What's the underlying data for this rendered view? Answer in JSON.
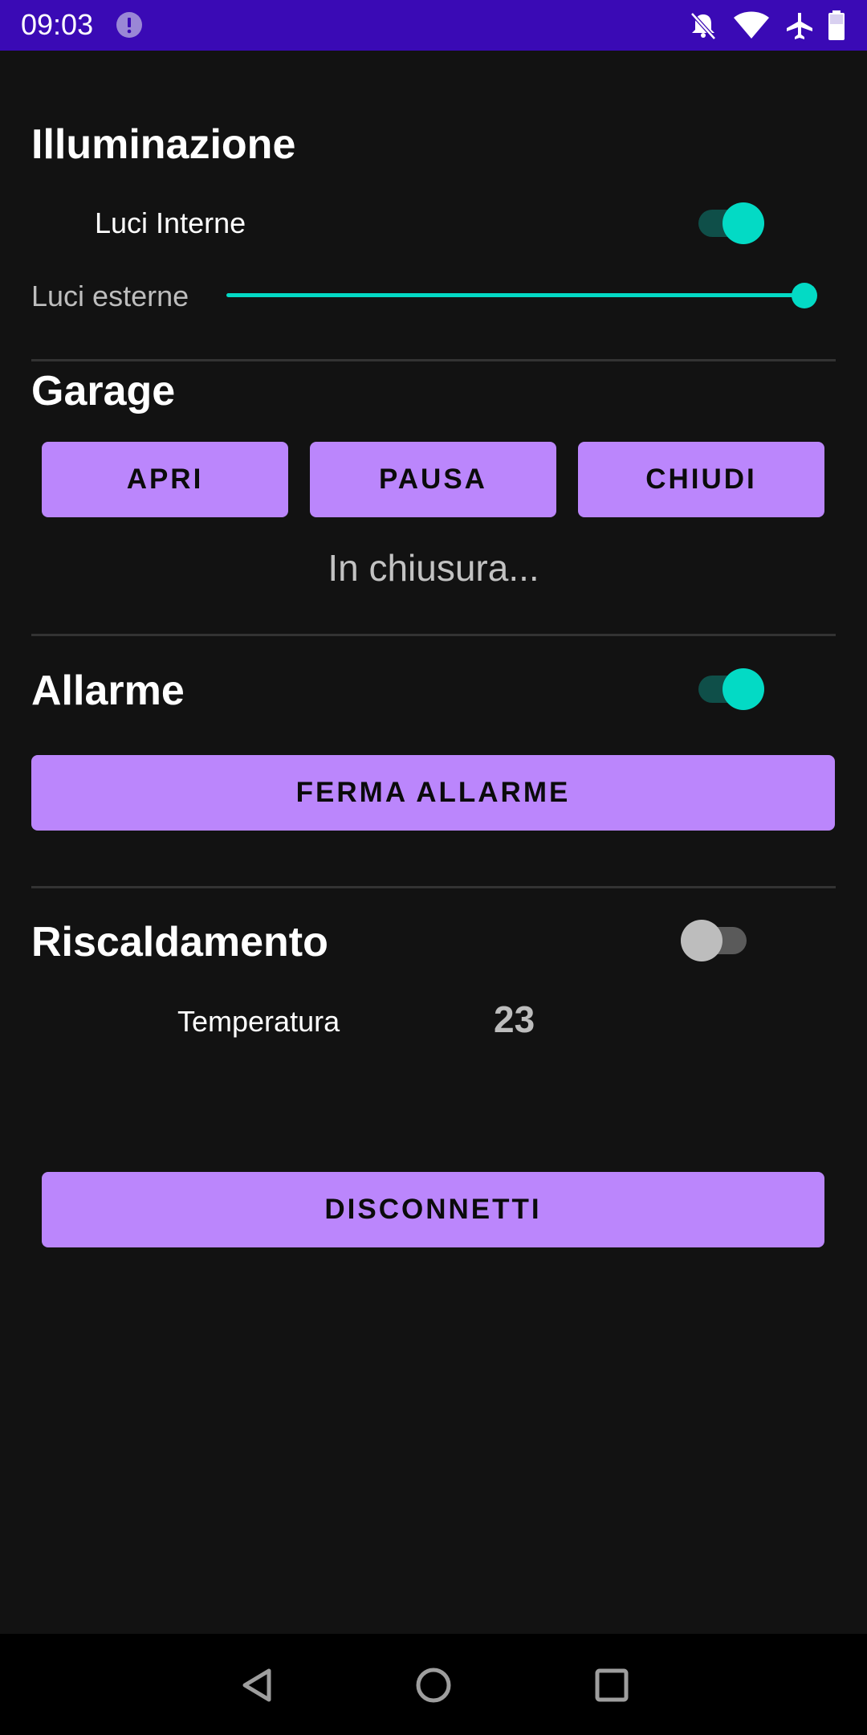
{
  "status_bar": {
    "time": "09:03",
    "color": "#3a0ab5",
    "icons": [
      "alert-icon",
      "bell-off-icon",
      "wifi-icon",
      "airplane-icon",
      "battery-icon"
    ]
  },
  "lighting": {
    "title": "Illuminazione",
    "internal_label": "Luci Interne",
    "internal_on": true,
    "external_label": "Luci esterne",
    "external_level": 1.0
  },
  "garage": {
    "title": "Garage",
    "buttons": [
      "APRI",
      "PAUSA",
      "CHIUDI"
    ],
    "status": "In chiusura..."
  },
  "alarm": {
    "title": "Allarme",
    "on": true,
    "stop_button": "FERMA ALLARME"
  },
  "heating": {
    "title": "Riscaldamento",
    "on": false,
    "temperature_label": "Temperatura",
    "temperature_value": "23"
  },
  "disconnect_button": "DISCONNETTI",
  "colors": {
    "accent": "#03dac5",
    "button": "#bb86fc",
    "background": "#121212"
  },
  "nav_icons": [
    "back-icon",
    "home-icon",
    "recents-icon"
  ]
}
